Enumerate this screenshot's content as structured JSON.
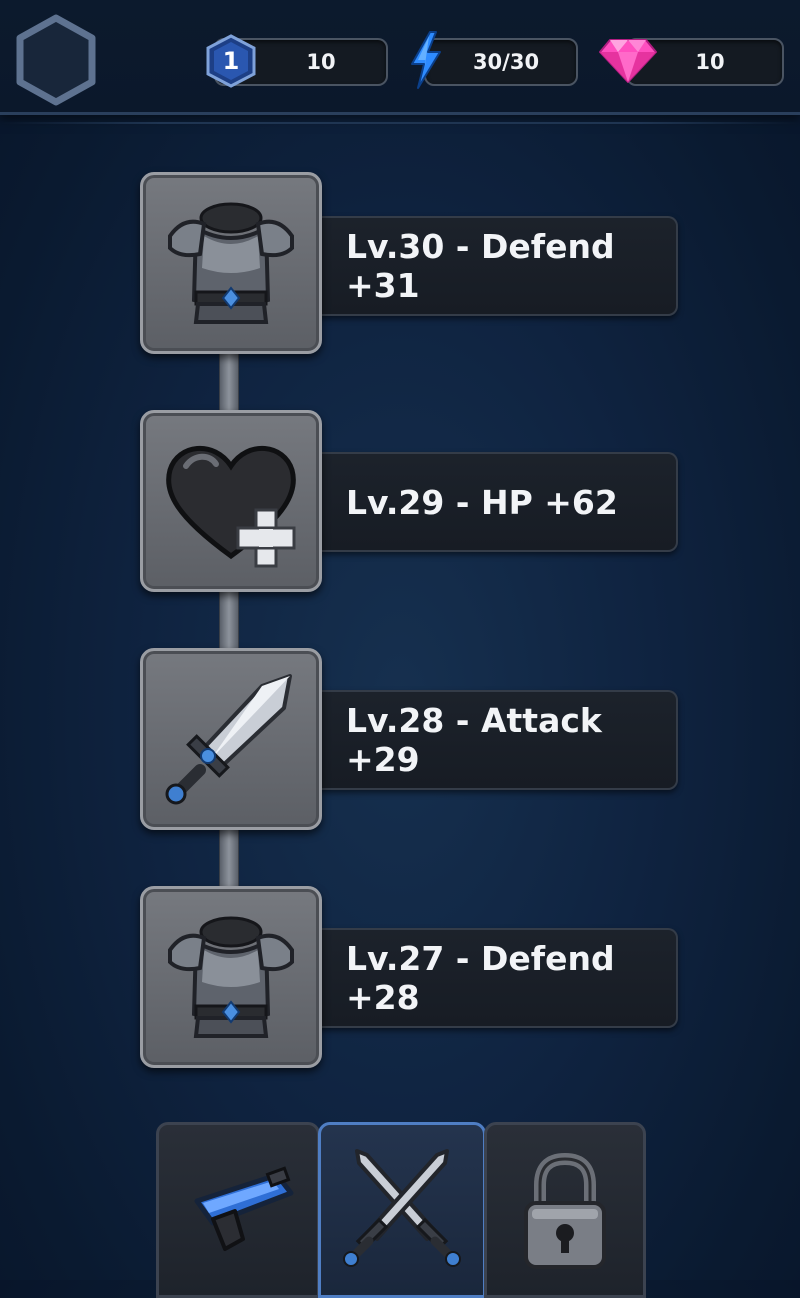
{
  "header": {
    "level": "1",
    "level_value": "10",
    "energy": "30/30",
    "gems": "10"
  },
  "skills": [
    {
      "label": "Lv.30 - Defend +31",
      "icon": "armor-icon"
    },
    {
      "label": "Lv.29 - HP +62",
      "icon": "heart-plus-icon"
    },
    {
      "label": "Lv.28 - Attack +29",
      "icon": "sword-icon"
    },
    {
      "label": "Lv.27 - Defend +28",
      "icon": "armor-icon"
    }
  ],
  "tabs": [
    {
      "icon": "blaster-icon",
      "active": false
    },
    {
      "icon": "crossed-swords-icon",
      "active": true
    },
    {
      "icon": "lock-icon",
      "active": false
    }
  ],
  "colors": {
    "accent_blue": "#2f6fd6",
    "gem_pink": "#ff5fc8",
    "energy_blue": "#2e8bff"
  }
}
